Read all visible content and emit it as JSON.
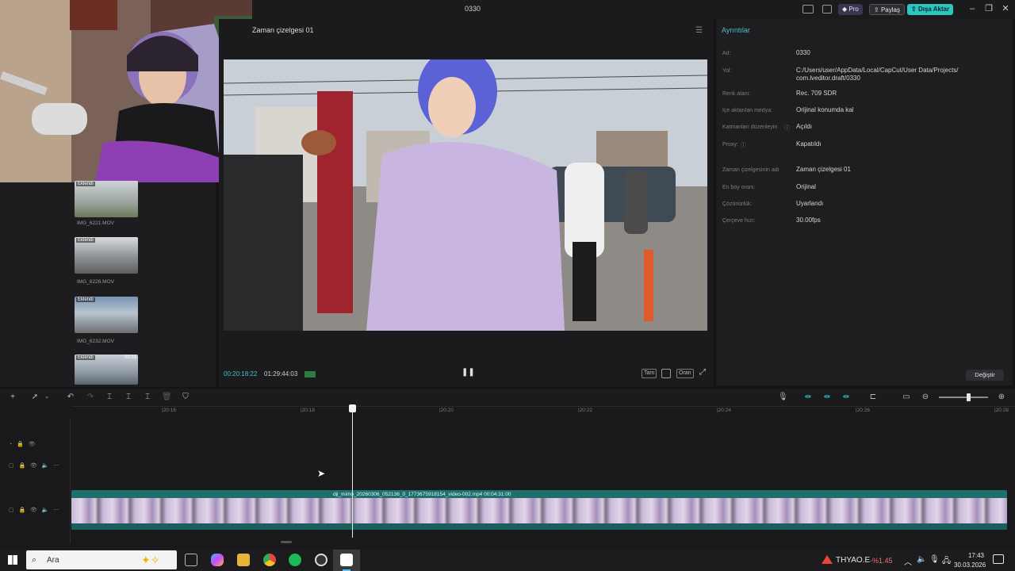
{
  "window": {
    "title": "0330",
    "pro_label": "Pro",
    "share_label": "Paylaş",
    "export_label": "Dışa Aktar",
    "accent": "#2cc5c0"
  },
  "player": {
    "title": "Zaman çizelgesi 01",
    "current_time": "00:20:18:22",
    "total_time": "01:29:44:03",
    "btn_full": "Tam",
    "btn_ratio": "Oran"
  },
  "details": {
    "title": "Ayrıntılar",
    "rows": [
      {
        "label": "Ad:",
        "value": "0330"
      },
      {
        "label": "Yol:",
        "value": "C:/Users/user/AppData/Local/CapCut/User Data/Projects/ com.lveditor.draft/0330"
      },
      {
        "label": "Renk alanı:",
        "value": "Rec. 709 SDR"
      },
      {
        "label": "İçe aktarılan medya:",
        "value": "Orijinal konumda kal"
      },
      {
        "label": "Katmanları düzenleyin",
        "value": "Açıldı"
      },
      {
        "label": "Proxy:",
        "value": "Kapatıldı"
      },
      {
        "label": "Zaman çizelgesinin adı",
        "value": "Zaman çizelgesi 01"
      },
      {
        "label": "En boy oranı:",
        "value": "Orijinal"
      },
      {
        "label": "Çözünürlük:",
        "value": "Uyarlandı"
      },
      {
        "label": "Çerçeve hızı:",
        "value": "30.00fps"
      }
    ],
    "change_label": "Değiştir"
  },
  "media": {
    "items": [
      {
        "name": "IMG_6221.MOV",
        "badge": "Eklendi",
        "duration": ""
      },
      {
        "name": "IMG_6226.MOV",
        "badge": "Eklendi",
        "duration": ""
      },
      {
        "name": "IMG_6232.MOV",
        "badge": "Eklendi",
        "duration": ""
      },
      {
        "name": "",
        "badge": "Eklendi",
        "duration": "00:31"
      }
    ]
  },
  "timeline": {
    "ruler": [
      "|20:16",
      "|20:18",
      "|20:20",
      "|20:22",
      "|20:24",
      "|20:26",
      "|20:28"
    ],
    "clip_label": "dji_mimo_20260306_052136_0_1773675918154_video-002.mp4   00:04:31:00"
  },
  "taskbar": {
    "search_label": "Ara",
    "ticker": "THYAO.E",
    "ticker_change": "-%1.45",
    "time": "17:43",
    "date": "30.03.2026"
  }
}
